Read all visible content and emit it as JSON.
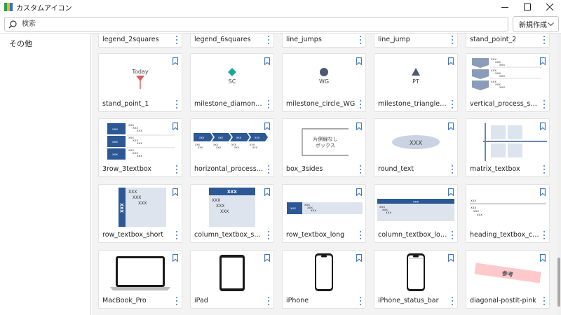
{
  "window": {
    "title": "カスタムアイコン"
  },
  "search": {
    "placeholder": "検索"
  },
  "toolbar": {
    "new_label": "新規作成"
  },
  "sidebar": {
    "items": [
      {
        "label": "その他"
      }
    ]
  },
  "cards_top": [
    {
      "label": "legend_2squares"
    },
    {
      "label": "legend_6squares"
    },
    {
      "label": "line_jumps"
    },
    {
      "label": "line_jump"
    },
    {
      "label": "stand_point_2"
    }
  ],
  "cards": [
    {
      "label": "stand_point_1",
      "preview_text": "Today"
    },
    {
      "label": "milestone_diamond_SC",
      "preview_text": "SC"
    },
    {
      "label": "milestone_circle_WG",
      "preview_text": "WG"
    },
    {
      "label": "milestone_triangle_PT",
      "preview_text": "PT"
    },
    {
      "label": "vertical_process_sequence"
    },
    {
      "label": "3row_3textbox"
    },
    {
      "label": "horizontal_process_sequence"
    },
    {
      "label": "box_3sides",
      "preview_text": [
        "片側線なし",
        "ボックス"
      ]
    },
    {
      "label": "round_text",
      "preview_text": "XXX"
    },
    {
      "label": "matrix_textbox"
    },
    {
      "label": "row_textbox_short"
    },
    {
      "label": "column_textbox_short"
    },
    {
      "label": "row_textbox_long"
    },
    {
      "label": "column_textbox_long"
    },
    {
      "label": "heading_textbox_column"
    },
    {
      "label": "MacBook_Pro"
    },
    {
      "label": "iPad"
    },
    {
      "label": "iPhone"
    },
    {
      "label": "iPhone_status_bar"
    },
    {
      "label": "diagonal-postit-pink",
      "preview_text": "参考"
    }
  ],
  "preview_tokens": {
    "short": "XXX",
    "small": "xxx"
  },
  "colors": {
    "accent": "#3b74c4",
    "navy": "#2d5896",
    "pin_red": "#e05a5a",
    "teal": "#1aa89a",
    "slate": "#4b5b73",
    "pale_blue": "#dde4ee",
    "pink": "#ffc9cc"
  },
  "icons": {
    "bookmark": "bookmark-icon",
    "kebab": "more-vertical-icon",
    "search": "search-icon",
    "dropdown": "chevron-down-icon"
  }
}
